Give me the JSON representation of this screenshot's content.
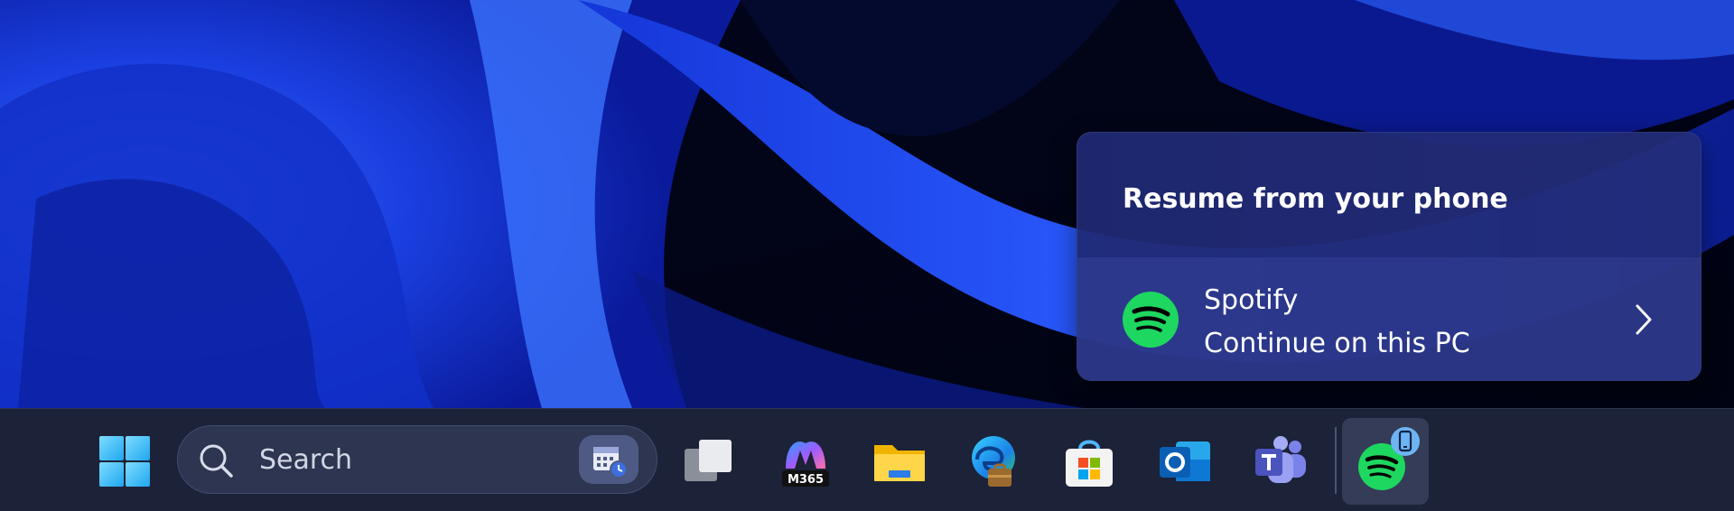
{
  "popup": {
    "title": "Resume from your phone",
    "app_name": "Spotify",
    "action": "Continue on this PC",
    "app_icon": "spotify-icon"
  },
  "taskbar": {
    "search_placeholder": "Search",
    "apps": [
      {
        "name": "task-view",
        "icon": "task-view-icon"
      },
      {
        "name": "microsoft-365",
        "icon": "m365-icon",
        "label": "M365"
      },
      {
        "name": "file-explorer",
        "icon": "folder-icon"
      },
      {
        "name": "edge",
        "icon": "edge-icon"
      },
      {
        "name": "microsoft-store",
        "icon": "store-icon"
      },
      {
        "name": "outlook",
        "icon": "outlook-icon"
      },
      {
        "name": "teams",
        "icon": "teams-icon"
      },
      {
        "name": "spotify",
        "icon": "spotify-icon"
      }
    ]
  },
  "colors": {
    "spotify_green": "#1ed760",
    "popup_bg": "#202a76",
    "taskbar_bg": "#1c2237"
  }
}
